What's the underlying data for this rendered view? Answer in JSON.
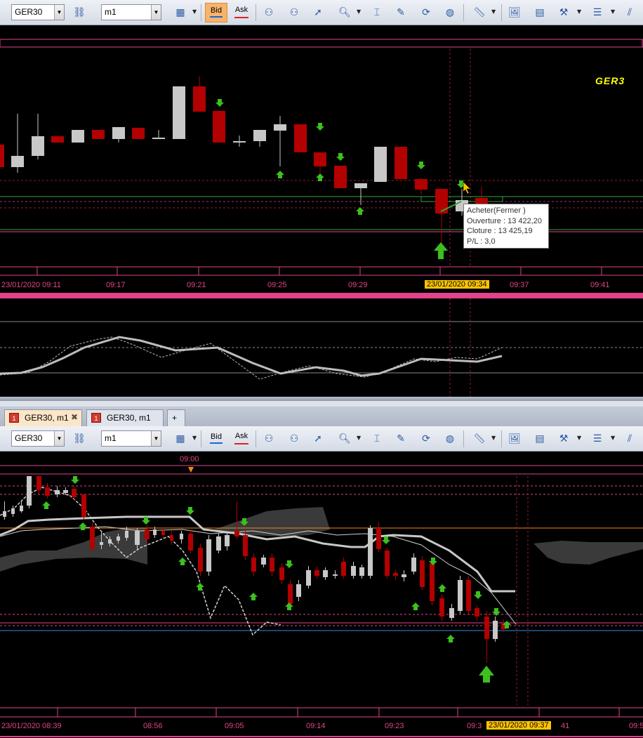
{
  "toolbar": {
    "symbol": "GER30",
    "timeframe": "m1",
    "bid_label": "Bid",
    "ask_label": "Ask"
  },
  "top_chart": {
    "title": "GER3",
    "time_labels": [
      "23/01/2020 09:11",
      "09:17",
      "09:21",
      "09:25",
      "09:29",
      "09:37",
      "09:41"
    ],
    "highlighted_time": "23/01/2020 09:34",
    "tooltip": {
      "line1": "Acheter(Fermer )",
      "line2": "Ouverture : 13 422,20",
      "line3": "Cloture : 13 425,19",
      "line4": "P/L : 3,0"
    }
  },
  "tabs": [
    {
      "label": "GER30, m1",
      "icon": "1",
      "active": true
    },
    {
      "label": "GER30, m1",
      "icon": "1",
      "active": false
    }
  ],
  "tab_add_label": "+",
  "bottom_chart": {
    "top_time_marker": "09:00",
    "time_labels": [
      "23/01/2020 08:39",
      "08:56",
      "09:05",
      "09:14",
      "09:23",
      "09:3",
      "41",
      "09:5"
    ],
    "highlighted_time": "23/01/2020 09:37"
  },
  "colors": {
    "bull_candle": "#c8c8c8",
    "bear_candle": "#b30000",
    "axis_pink": "#e0448a",
    "arrow_green": "#3cbf1f",
    "highlight": "#ffc400"
  }
}
